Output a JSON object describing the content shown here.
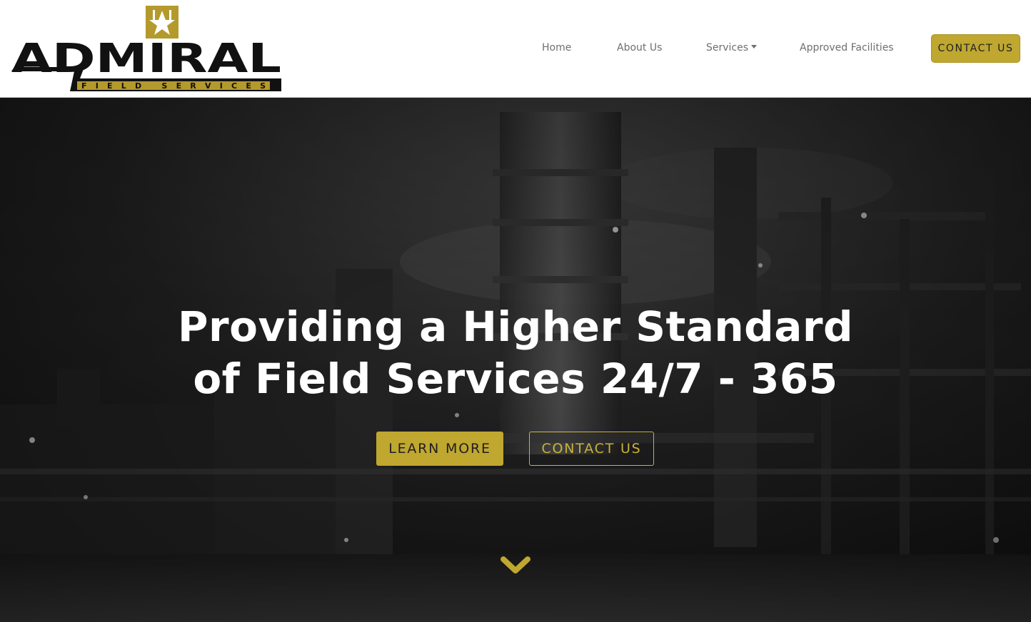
{
  "brand": {
    "name": "ADMIRAL",
    "tagline": "FIELD SERVICES",
    "emblem_icon": "star-icon",
    "accent_color": "#bfa730",
    "logo_text_color": "#111111"
  },
  "nav": {
    "items": [
      {
        "label": "Home"
      },
      {
        "label": "About Us"
      },
      {
        "label": "Services",
        "has_dropdown": true
      },
      {
        "label": "Approved Facilities"
      }
    ],
    "cta_label": "CONTACT US"
  },
  "hero": {
    "headline_line1": "Providing a Higher Standard",
    "headline_line2": "of Field Services 24/7 - 365",
    "primary_button": "LEARN MORE",
    "secondary_button": "CONTACT US",
    "scroll_icon": "chevron-down-icon",
    "background_description_icon": "refinery-image"
  }
}
